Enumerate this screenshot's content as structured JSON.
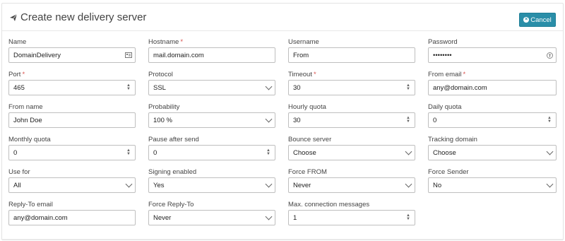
{
  "header": {
    "title": "Create new delivery server",
    "cancel_label": "Cancel"
  },
  "colors": {
    "accent": "#2a8ea8",
    "required": "#d9534f"
  },
  "fields": {
    "name": {
      "label": "Name",
      "value": "DomainDelivery",
      "icon": "id-card-icon"
    },
    "hostname": {
      "label": "Hostname",
      "required": "*",
      "value": "mail.domain.com"
    },
    "username": {
      "label": "Username",
      "value": "From"
    },
    "password": {
      "label": "Password",
      "value": "••••••••",
      "icon": "key-icon"
    },
    "port": {
      "label": "Port",
      "required": "*",
      "value": "465"
    },
    "protocol": {
      "label": "Protocol",
      "value": "SSL"
    },
    "timeout": {
      "label": "Timeout",
      "required": "*",
      "value": "30"
    },
    "from_email": {
      "label": "From email",
      "required": "*",
      "value": "any@domain.com"
    },
    "from_name": {
      "label": "From name",
      "value": "John Doe"
    },
    "probability": {
      "label": "Probability",
      "value": "100 %"
    },
    "hourly_quota": {
      "label": "Hourly quota",
      "value": "30"
    },
    "daily_quota": {
      "label": "Daily quota",
      "value": "0"
    },
    "monthly_quota": {
      "label": "Monthly quota",
      "value": "0"
    },
    "pause_after_send": {
      "label": "Pause after send",
      "value": "0"
    },
    "bounce_server": {
      "label": "Bounce server",
      "value": "Choose"
    },
    "tracking_domain": {
      "label": "Tracking domain",
      "value": "Choose"
    },
    "use_for": {
      "label": "Use for",
      "value": "All"
    },
    "signing_enabled": {
      "label": "Signing enabled",
      "value": "Yes"
    },
    "force_from": {
      "label": "Force FROM",
      "value": "Never"
    },
    "force_sender": {
      "label": "Force Sender",
      "value": "No"
    },
    "reply_to_email": {
      "label": "Reply-To email",
      "value": "any@domain.com"
    },
    "force_reply_to": {
      "label": "Force Reply-To",
      "value": "Never"
    },
    "max_connection_messages": {
      "label": "Max. connection messages",
      "value": "1"
    }
  }
}
